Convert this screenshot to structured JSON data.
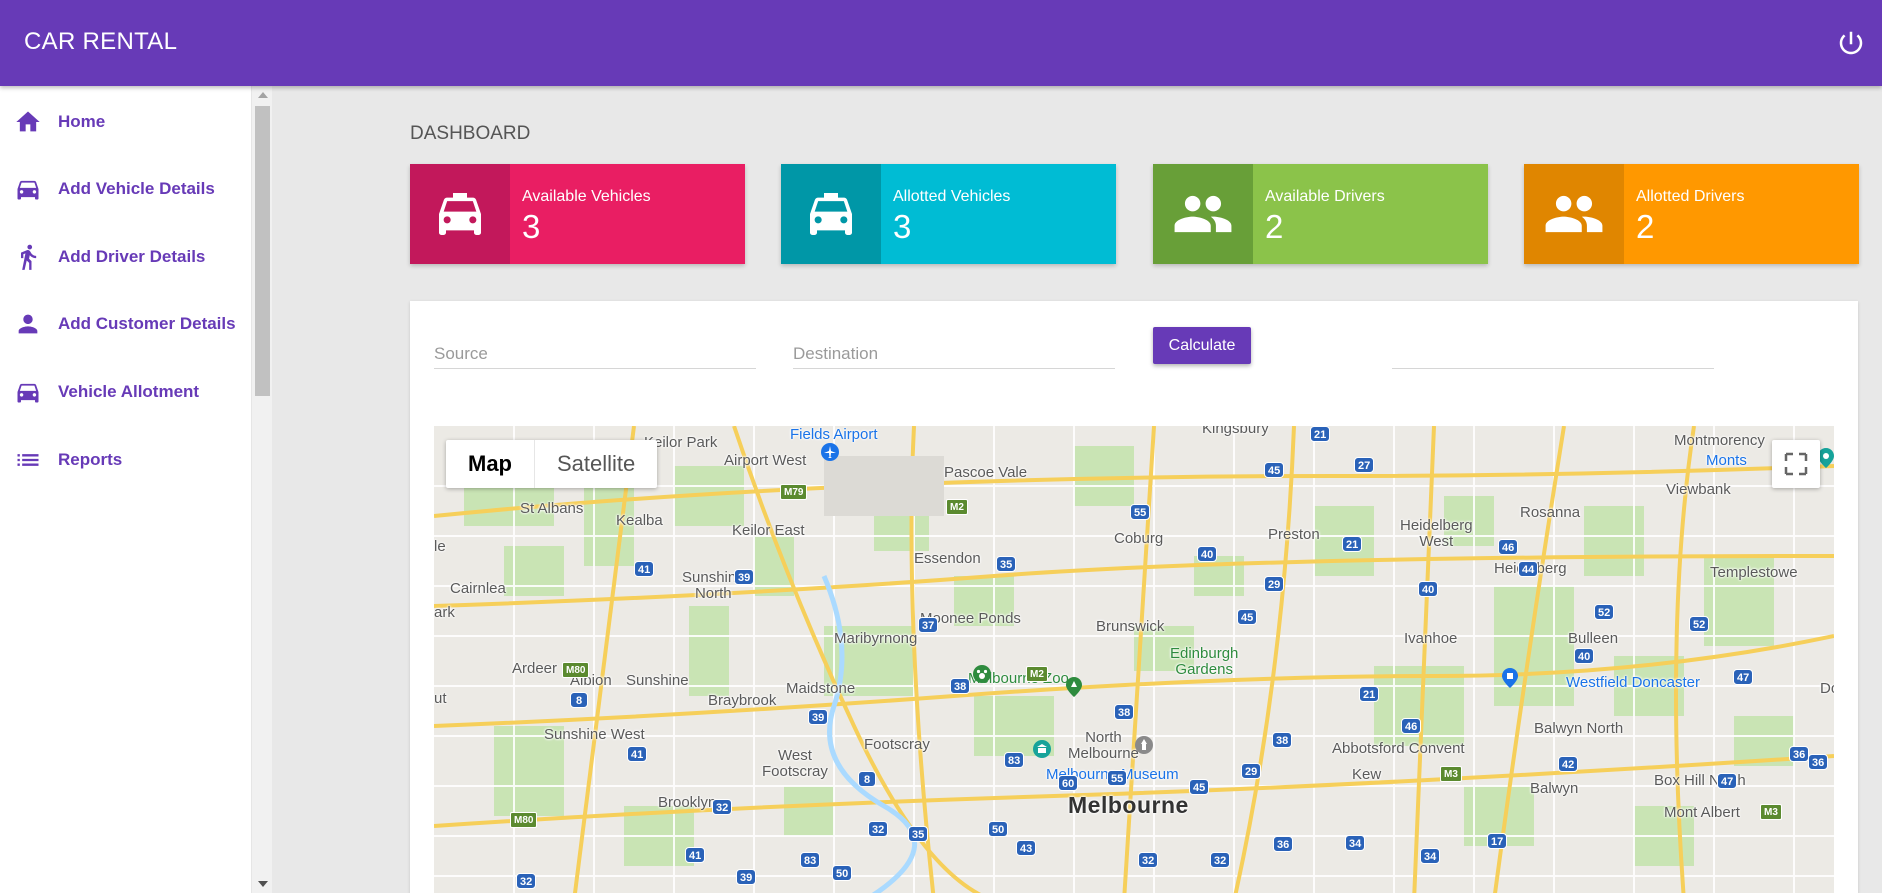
{
  "app": {
    "title": "CAR RENTAL",
    "power_icon": "power-icon"
  },
  "sidebar": {
    "items": [
      {
        "label": "Home",
        "icon": "home-icon"
      },
      {
        "label": "Add Vehicle Details",
        "icon": "car-icon"
      },
      {
        "label": "Add Driver Details",
        "icon": "walking-person-icon"
      },
      {
        "label": "Add Customer Details",
        "icon": "person-icon"
      },
      {
        "label": "Vehicle Allotment",
        "icon": "car-icon"
      },
      {
        "label": "Reports",
        "icon": "list-icon"
      }
    ]
  },
  "dashboard": {
    "title": "DASHBOARD",
    "cards": [
      {
        "title": "Available Vehicles",
        "value": "3",
        "icon": "taxi-icon",
        "color": "#e91e63",
        "dark": "#c2185b"
      },
      {
        "title": "Allotted Vehicles",
        "value": "3",
        "icon": "taxi-icon",
        "color": "#00bcd4",
        "dark": "#0097a7"
      },
      {
        "title": "Available Drivers",
        "value": "2",
        "icon": "people-icon",
        "color": "#8bc34a",
        "dark": "#689f38"
      },
      {
        "title": "Allotted Drivers",
        "value": "2",
        "icon": "people-icon",
        "color": "#ff9800",
        "dark": "#e08600"
      }
    ]
  },
  "route_form": {
    "source_placeholder": "Source",
    "destination_placeholder": "Destination",
    "calculate_label": "Calculate",
    "result_value": ""
  },
  "map": {
    "type_map_label": "Map",
    "type_satellite_label": "Satellite",
    "places": {
      "fields_airport": "Fields Airport",
      "kingsbury": "Kingsbury",
      "keilor_park": "Keilor Park",
      "airport_west": "Airport West",
      "pascoe_vale": "Pascoe Vale",
      "montmorency": "Montmorency",
      "monts": "Monts",
      "st_albans": "St Albans",
      "kealba": "Kealba",
      "keilor_east": "Keilor East",
      "coburg": "Coburg",
      "preston": "Preston",
      "heidelberg_west": "Heidelberg\nWest",
      "rosanna": "Rosanna",
      "viewbank": "Viewbank",
      "le": "le",
      "essendon": "Essendon",
      "heidelberg": "Heidelberg",
      "templestowe": "Templestowe",
      "sunshine_north": "Sunshine\nNorth",
      "cairnlea": "Cairnlea",
      "ark": "ark",
      "moonee_ponds": "Moonee Ponds",
      "brunswick": "Brunswick",
      "maribyrnong": "Maribyrnong",
      "ivanhoe": "Ivanhoe",
      "bulleen": "Bulleen",
      "edinburgh_gardens": "Edinburgh\nGardens",
      "ardeer": "Ardeer",
      "albion": "Albion",
      "sunshine": "Sunshine",
      "melbourne_zoo": "Melbourne Zoo",
      "westfield_doncaster": "Westfield Doncaster",
      "do": "Do",
      "ut": "ut",
      "braybrook": "Braybrook",
      "maidstone": "Maidstone",
      "sunshine_west": "Sunshine West",
      "footscray": "Footscray",
      "north_melbourne": "North\nMelbourne",
      "abbotsford_convent": "Abbotsford Convent",
      "balwyn_north": "Balwyn North",
      "west_footscray": "West\nFootscray",
      "melbourne_museum": "Melbourne Museum",
      "kew": "Kew",
      "box_hill_north": "Box Hill North",
      "brooklyn": "Brooklyn",
      "balwyn": "Balwyn",
      "melbourne": "Melbourne",
      "mont_albert": "Mont Albert"
    },
    "shields": [
      "M79",
      "M2",
      "M80",
      "M2",
      "M80",
      "M3",
      "M3",
      "21",
      "27",
      "45",
      "41",
      "39",
      "35",
      "55",
      "40",
      "21",
      "46",
      "44",
      "40",
      "29",
      "45",
      "52",
      "52",
      "37",
      "38",
      "40",
      "47",
      "8",
      "39",
      "38",
      "21",
      "46",
      "36",
      "41",
      "83",
      "38",
      "60",
      "55",
      "45",
      "29",
      "42",
      "47",
      "36",
      "8",
      "32",
      "32",
      "35",
      "50",
      "43",
      "32",
      "83",
      "41",
      "39",
      "50",
      "32",
      "36",
      "34",
      "17",
      "34",
      "32"
    ]
  }
}
